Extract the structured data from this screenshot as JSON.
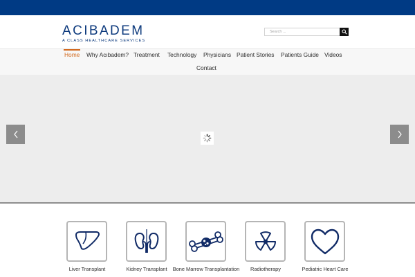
{
  "brand": {
    "name": "ACIBADEM",
    "tagline": "A CLASS HEALTHCARE SERVICES",
    "color": "#0d3a7d"
  },
  "topbar": {
    "color": "#003a84"
  },
  "search": {
    "placeholder": "Search ..."
  },
  "nav": {
    "accent": "#d2691e",
    "items": [
      {
        "label": "Home",
        "active": true
      },
      {
        "label": "Why Acıbadem?"
      },
      {
        "label": "Treatment"
      },
      {
        "label": "Technology"
      },
      {
        "label": "Physicians"
      },
      {
        "label": "Patient Stories"
      },
      {
        "label": "Patients Guide"
      },
      {
        "label": "Videos"
      },
      {
        "label": "Contact"
      }
    ]
  },
  "slider": {
    "prev_icon": "chevron-left-icon",
    "next_icon": "chevron-right-icon",
    "loading_icon": "spinner-icon"
  },
  "services": [
    {
      "label": "Liver Transplant",
      "icon": "liver-icon"
    },
    {
      "label": "Kidney Transplant",
      "icon": "kidneys-icon"
    },
    {
      "label": "Bone Marrow Transplantation",
      "icon": "bone-icon"
    },
    {
      "label": "Radiotherapy",
      "icon": "radiation-icon"
    },
    {
      "label": "Pediatric Heart Care",
      "icon": "heart-icon"
    }
  ]
}
